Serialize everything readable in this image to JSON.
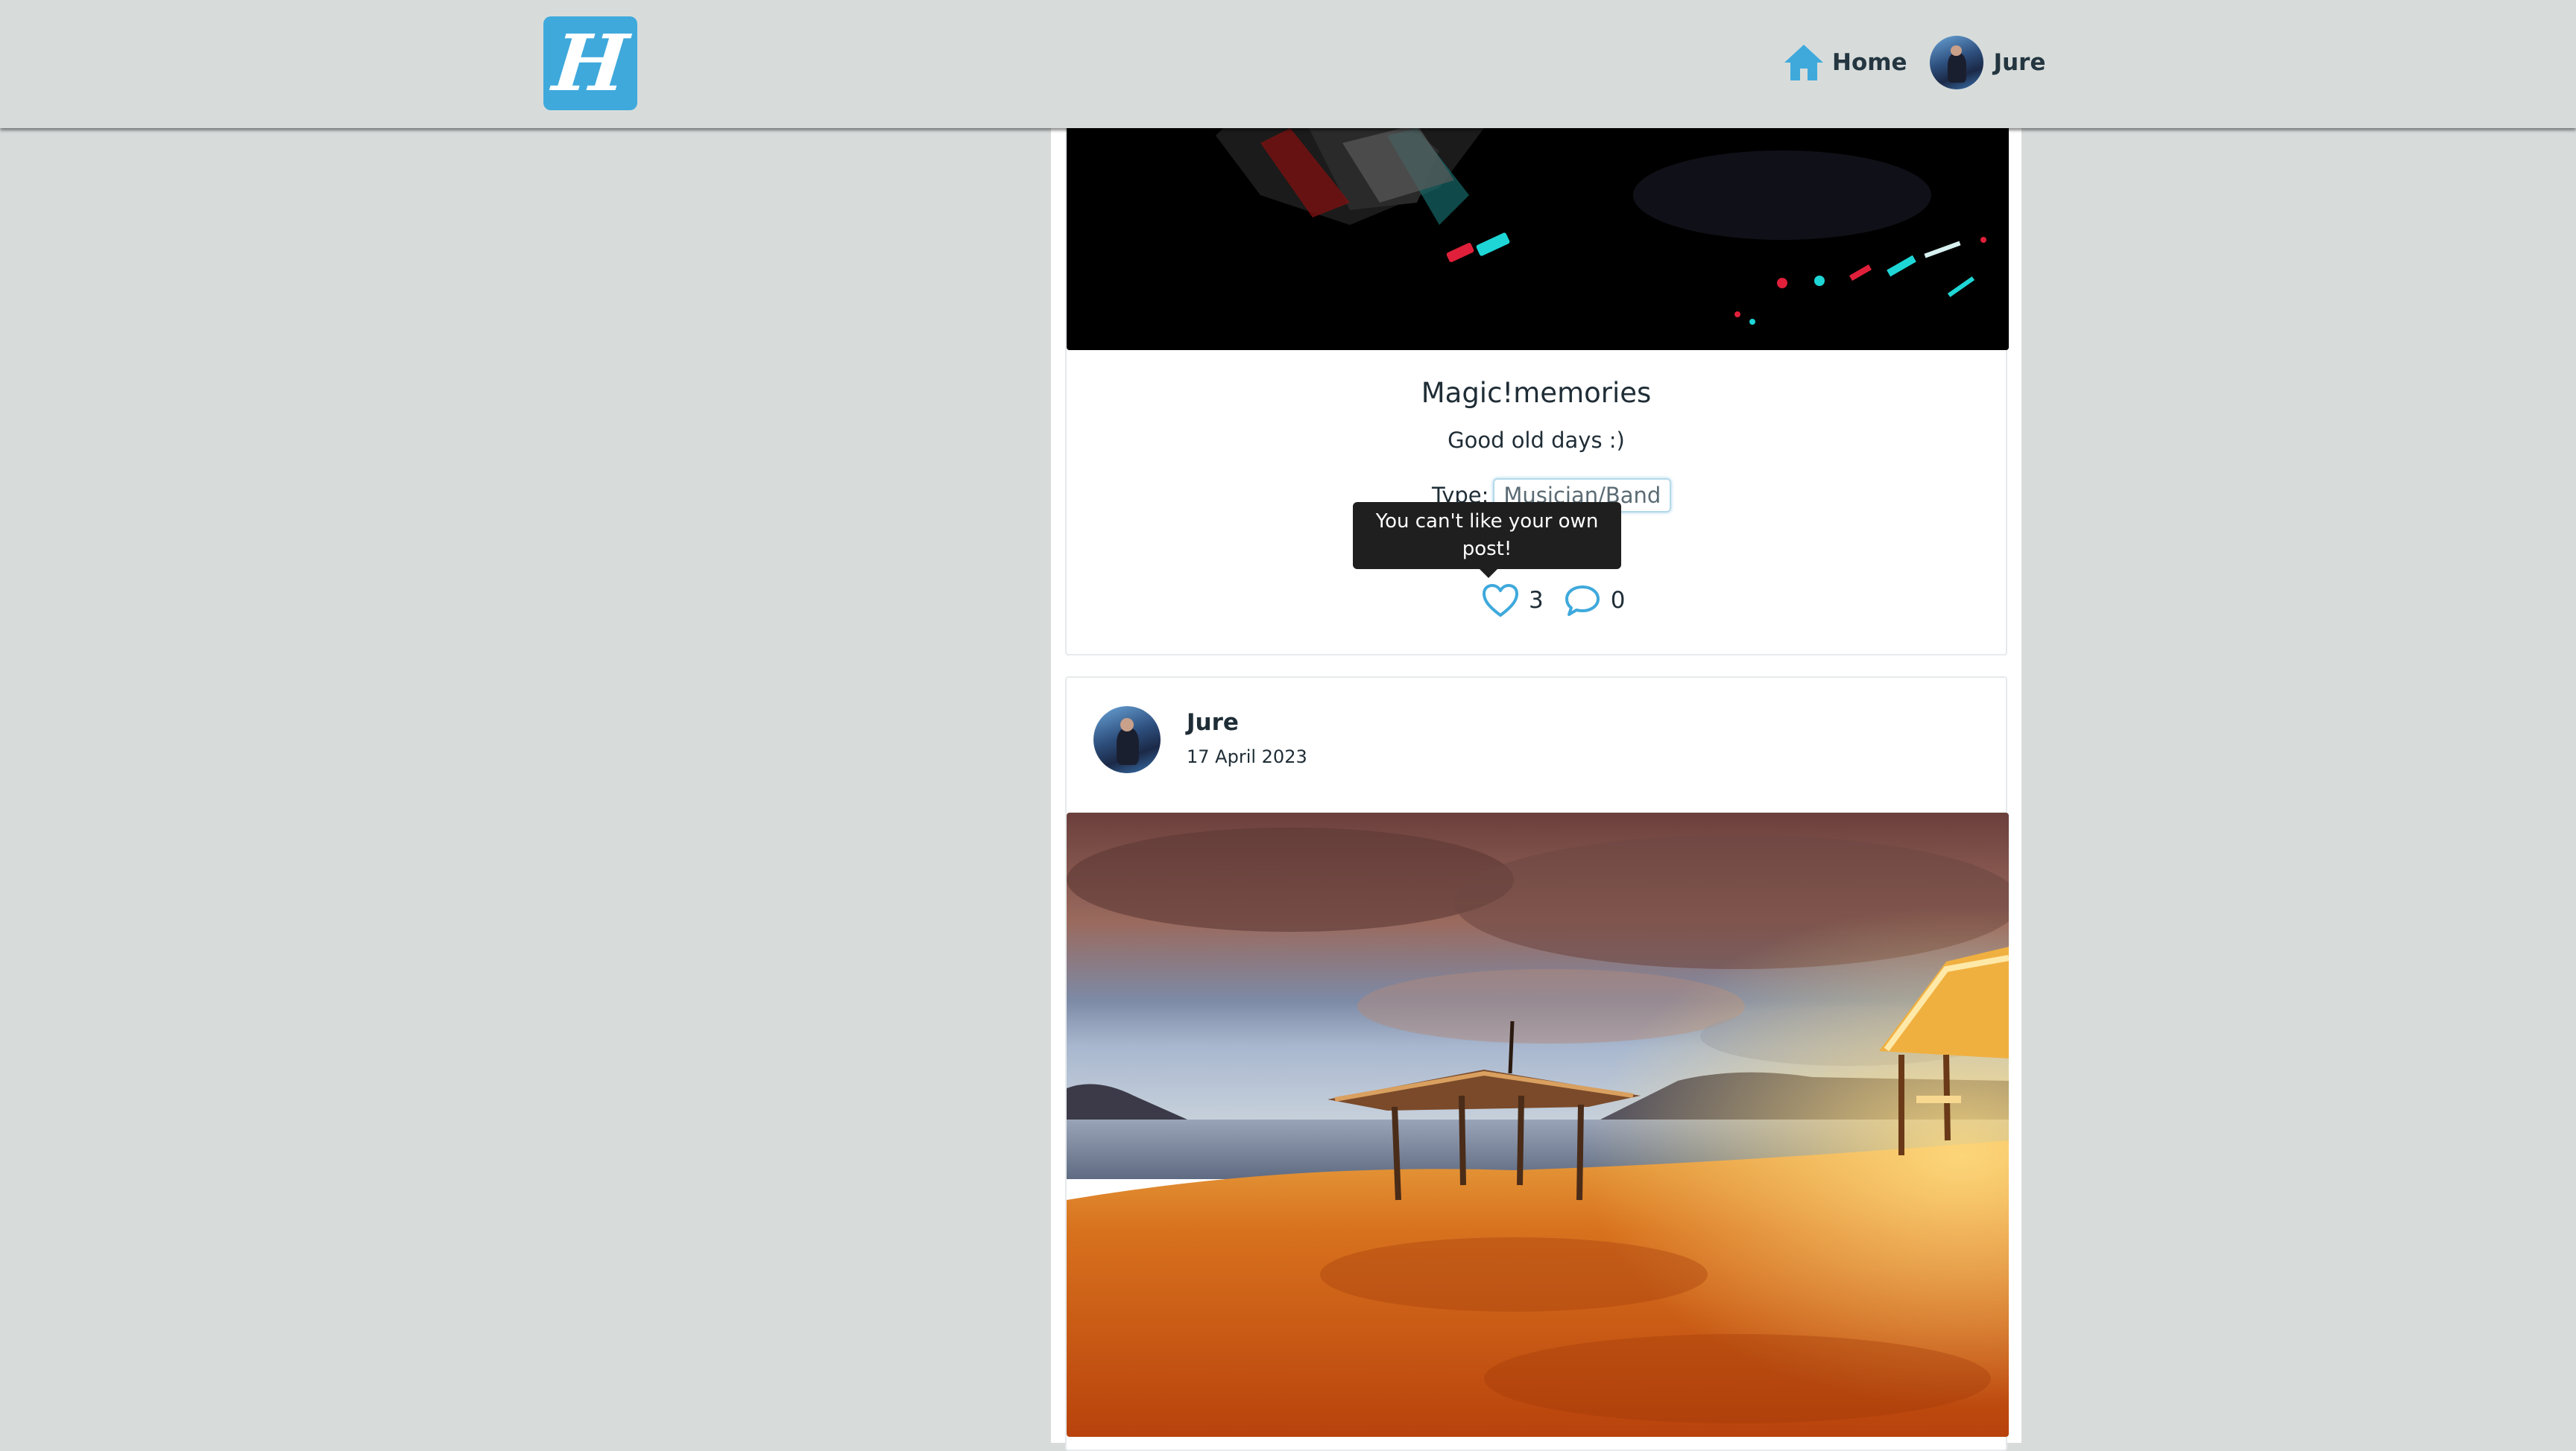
{
  "navbar": {
    "logo_letter": "H",
    "home_label": "Home",
    "user_name": "Jure"
  },
  "post1": {
    "title": "Magic!memories",
    "description": "Good old days :)",
    "type_label": "Type:",
    "type_value": "Musician/Band",
    "tooltip": "You can't like your own post!",
    "likes": "3",
    "comments": "0"
  },
  "post2": {
    "author": "Jure",
    "date": "17 April 2023"
  },
  "colors": {
    "accent": "#3fa9dc",
    "background": "#d7dcdb",
    "text": "#1f2d36"
  },
  "icons": {
    "home": "home-icon",
    "like": "heart-icon",
    "comment": "comment-icon"
  }
}
